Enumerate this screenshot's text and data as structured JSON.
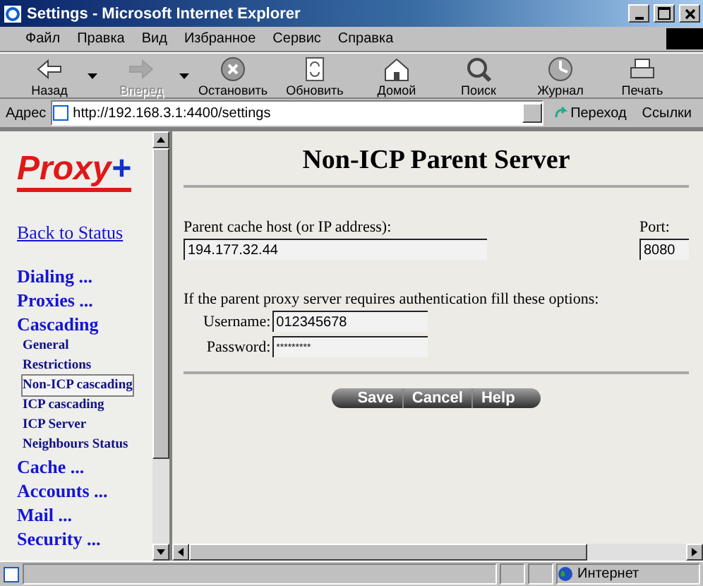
{
  "window": {
    "title": "Settings - Microsoft Internet Explorer"
  },
  "menu": [
    "Файл",
    "Правка",
    "Вид",
    "Избранное",
    "Сервис",
    "Справка"
  ],
  "toolbar": [
    {
      "label": "Назад",
      "kind": "back",
      "disabled": false,
      "dropdown": true
    },
    {
      "label": "Вперед",
      "kind": "forward",
      "disabled": true,
      "dropdown": true
    },
    {
      "label": "Остановить",
      "kind": "stop",
      "disabled": false,
      "dropdown": false
    },
    {
      "label": "Обновить",
      "kind": "refresh",
      "disabled": false,
      "dropdown": false
    },
    {
      "label": "Домой",
      "kind": "home",
      "disabled": false,
      "dropdown": false
    },
    {
      "label": "Поиск",
      "kind": "search",
      "disabled": false,
      "dropdown": false
    },
    {
      "label": "Журнал",
      "kind": "history",
      "disabled": false,
      "dropdown": false
    },
    {
      "label": "Печать",
      "kind": "print",
      "disabled": false,
      "dropdown": false
    }
  ],
  "address_bar": {
    "label": "Адрес",
    "value": "http://192.168.3.1:4400/settings",
    "go": "Переход",
    "links": "Ссылки"
  },
  "sidebar": {
    "logo": "Proxy",
    "logo_mark": "+",
    "items": [
      {
        "label": "Back to Status",
        "kind": "link",
        "selected": false
      },
      {
        "label": "Dialing ...",
        "kind": "section",
        "selected": false
      },
      {
        "label": "Proxies ...",
        "kind": "section",
        "selected": false
      },
      {
        "label": "Cascading",
        "kind": "section",
        "selected": false
      },
      {
        "label": "General",
        "kind": "sub",
        "selected": false
      },
      {
        "label": "Restrictions",
        "kind": "sub",
        "selected": false
      },
      {
        "label": "Non-ICP cascading",
        "kind": "sub",
        "selected": true
      },
      {
        "label": "ICP cascading",
        "kind": "sub",
        "selected": false
      },
      {
        "label": "ICP Server",
        "kind": "sub",
        "selected": false
      },
      {
        "label": "Neighbours Status",
        "kind": "sub",
        "selected": false
      },
      {
        "label": "Cache ...",
        "kind": "section",
        "selected": false
      },
      {
        "label": "Accounts ...",
        "kind": "section",
        "selected": false
      },
      {
        "label": "Mail ...",
        "kind": "section",
        "selected": false
      },
      {
        "label": "Security ...",
        "kind": "section",
        "selected": false
      }
    ]
  },
  "main": {
    "heading": "Non-ICP Parent Server",
    "host_label": "Parent cache host (or IP address):",
    "host_value": "194.177.32.44",
    "port_label": "Port:",
    "port_value": "8080",
    "auth_note": "If the parent proxy server requires authentication fill these options:",
    "username_label": "Username:",
    "username_value": "012345678",
    "password_label": "Password:",
    "password_value": "*********",
    "buttons": [
      "Save",
      "Cancel",
      "Help"
    ]
  },
  "status_bar": {
    "zone": "Интернет"
  }
}
